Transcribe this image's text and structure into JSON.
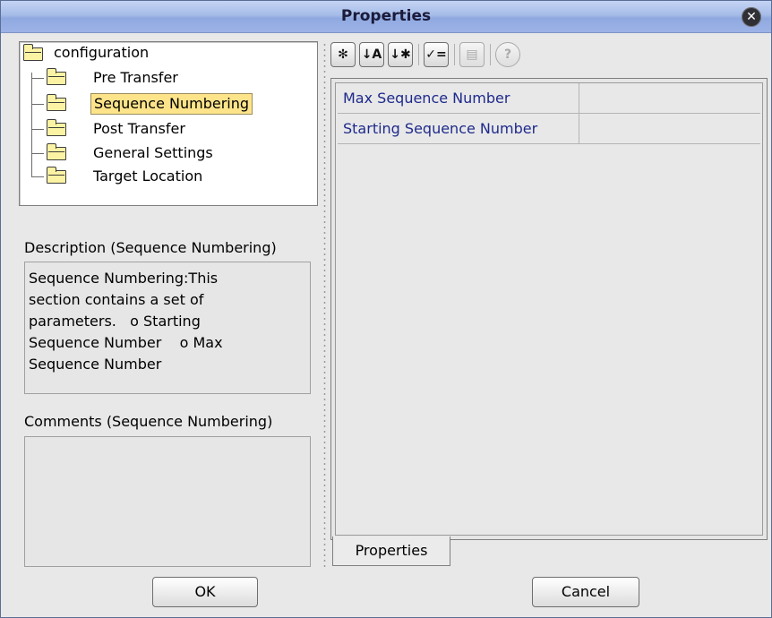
{
  "window": {
    "title": "Properties"
  },
  "tree": {
    "root": "configuration",
    "items": [
      {
        "label": "Pre Transfer",
        "selected": false
      },
      {
        "label": "Sequence Numbering",
        "selected": true
      },
      {
        "label": "Post Transfer",
        "selected": false
      },
      {
        "label": "General Settings",
        "selected": false
      },
      {
        "label": "Target Location",
        "selected": false
      }
    ]
  },
  "description": {
    "label": "Description (Sequence Numbering)",
    "text": "Sequence Numbering:This\nsection contains a set of\nparameters.   o Starting\nSequence Number    o Max\nSequence Number"
  },
  "comments": {
    "label": "Comments (Sequence Numbering)",
    "text": ""
  },
  "toolbar": {
    "buttons": [
      {
        "icon": "categorized-icon",
        "glyph": "✻",
        "enabled": true
      },
      {
        "icon": "sort-alphabetical-icon",
        "glyph": "↓A",
        "enabled": true
      },
      {
        "icon": "sort-by-type-icon",
        "glyph": "↓✱",
        "enabled": true
      },
      {
        "icon": "show-editable-icon",
        "glyph": "✓=",
        "enabled": true
      },
      {
        "icon": "properties-page-icon",
        "glyph": "▤",
        "enabled": false
      },
      {
        "icon": "help-icon",
        "glyph": "?",
        "enabled": false
      }
    ]
  },
  "properties": [
    {
      "name": "Max Sequence Number",
      "value": ""
    },
    {
      "name": "Starting Sequence Number",
      "value": ""
    }
  ],
  "tab": {
    "label": "Properties"
  },
  "buttons": {
    "ok": "OK",
    "cancel": "Cancel"
  },
  "colors": {
    "selection": "#fde48a",
    "property_name": "#1e2a8c",
    "title_bar": "#9db3e6"
  }
}
